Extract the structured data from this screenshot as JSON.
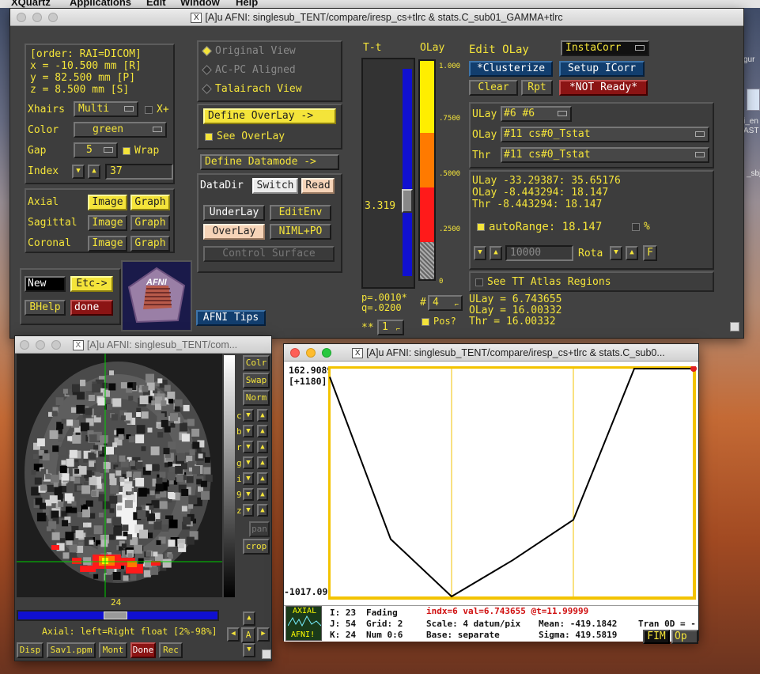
{
  "menubar": {
    "app": "XQuartz",
    "items": [
      "Applications",
      "Edit",
      "Window",
      "Help"
    ]
  },
  "main_window": {
    "title": "[A]u AFNI: singlesub_TENT/compare/iresp_cs+tlrc & stats.C_sub01_GAMMA+tlrc",
    "coords": {
      "order": "[order: RAI=DICOM]",
      "x": "x =   -10.500 mm [R]",
      "y": "y =    82.500 mm [P]",
      "z": "z =     8.500 mm [S]"
    },
    "xhairs_label": "Xhairs",
    "xhairs_value": "Multi",
    "xplus_label": "X+",
    "color_label": "Color",
    "color_value": "green",
    "gap_label": "Gap",
    "gap_value": "5",
    "wrap_label": "Wrap",
    "index_label": "Index",
    "index_value": "37",
    "views": [
      {
        "label": "Axial",
        "image": "Image",
        "graph": "Graph"
      },
      {
        "label": "Sagittal",
        "image": "Image",
        "graph": "Graph"
      },
      {
        "label": "Coronal",
        "image": "Image",
        "graph": "Graph"
      }
    ],
    "new_label": "New",
    "etc_label": "Etc->",
    "bhelp_label": "BHelp",
    "done_label": "done",
    "logo_text": "AFNI",
    "original_view": "Original View",
    "acpc_view": "AC-PC Aligned",
    "talairach_view": "Talairach View",
    "define_overlay": "Define OverLay ->",
    "see_overlay": "See OverLay",
    "define_datamode": "Define Datamode ->",
    "datadir": "DataDir",
    "switch": "Switch",
    "read": "Read",
    "underlay": "UnderLay",
    "editenv": "EditEnv",
    "overlay": "OverLay",
    "nimlpo": "NIML+PO",
    "control_surface": "Control Surface",
    "afni_tips": "AFNI Tips",
    "tt_label": "T-t",
    "olay_label": "OLay",
    "thresh_value": "3.319",
    "scale_ticks": [
      "1.000",
      ".7500",
      ".5000",
      ".2500",
      "0"
    ],
    "pq": [
      "p=.0010*",
      "q=.0200"
    ],
    "pos_label": "Pos?",
    "count_value": "4",
    "stars": "**",
    "stars_value": "1",
    "edit_olay": "Edit OLay",
    "instacorr": "InstaCorr",
    "clusterize": "*Clusterize",
    "setup_icorr": "Setup ICorr",
    "clear": "Clear",
    "rpt": "Rpt",
    "not_ready": "*NOT Ready*",
    "ulay_label": "ULay",
    "ulay_value": "#6 #6",
    "olay_row_label": "OLay",
    "olay_value": "#11 cs#0_Tstat",
    "thr_label": "Thr",
    "thr_value": "#11 cs#0_Tstat",
    "range_lines": [
      "ULay -33.29387: 35.65176",
      "OLay -8.443294:   18.147",
      "Thr  -8.443294:   18.147"
    ],
    "autorange": "autoRange: 18.147",
    "pct": "%",
    "rota_value": "10000",
    "rota_label": "Rota",
    "f_label": "F",
    "see_tt": "See TT Atlas Regions",
    "values": [
      "ULay = 6.743655",
      "OLay = 16.00332",
      "Thr  = 16.00332"
    ],
    "colors": {
      "yellow": "#f4e43a",
      "panel": "#3d3d3d"
    }
  },
  "image_window": {
    "title": "[A]u AFNI: singlesub_TENT/com...",
    "slice_label": "24",
    "buttons_right": [
      "Colr",
      "Swap",
      "Norm"
    ],
    "letters": [
      "c",
      "b",
      "r",
      "g",
      "i",
      "9",
      "z"
    ],
    "pan": "pan",
    "crop": "crop",
    "status": "Axial: left=Right float [2%-98%]",
    "bottom": [
      "Disp",
      "Sav1.ppm",
      "Mont",
      "Done",
      "Rec"
    ],
    "a_label": "A"
  },
  "graph_window": {
    "title": "[A]u AFNI: singlesub_TENT/compare/iresp_cs+tlrc & stats.C_sub0...",
    "ymax": "162.9089",
    "yoff": "[+1180]",
    "ymin": "-1017.091",
    "chart_data": {
      "type": "line",
      "x": [
        0,
        1,
        2,
        3,
        4,
        5,
        6
      ],
      "values": [
        120,
        -720,
        -1017.091,
        -830,
        -620,
        162.9089,
        162.9089
      ],
      "ylim": [
        -1017.091,
        162.9089
      ],
      "grid": "vertical"
    },
    "info_left": [
      "I: 23",
      "J: 54",
      "K: 24"
    ],
    "info_mid": [
      "Fading",
      "Grid:     2",
      "Num  0:6"
    ],
    "indx_line": "indx=6 val=6.743655 @t=11.99999",
    "scale_line": "Scale: 4 datum/pix",
    "base_line": "Base: separate",
    "mean_line": "Mean:  -419.1842",
    "sigma_line": "Sigma:  419.5819",
    "tran_line": "Tran 0D = -",
    "axial_label": "AXIAL",
    "afni_label": "AFNI!",
    "fim": "FIM",
    "opt": "Op"
  },
  "desktop_labels": [
    "gur",
    "i_en",
    "AST",
    "_sbj"
  ]
}
